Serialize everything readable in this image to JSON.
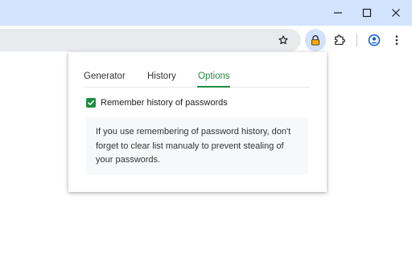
{
  "window_controls": {
    "minimize_icon": "minimize-icon",
    "maximize_icon": "maximize-icon",
    "close_icon": "close-icon"
  },
  "toolbar": {
    "icons": [
      "star-icon",
      "lock-icon",
      "puzzle-icon",
      "profile-icon",
      "more-vert-icon"
    ]
  },
  "popup": {
    "tabs": [
      {
        "label": "Generator",
        "active": false
      },
      {
        "label": "History",
        "active": false
      },
      {
        "label": "Options",
        "active": true
      }
    ],
    "options": {
      "remember_history": {
        "label": "Remember history of passwords",
        "checked": true
      }
    },
    "note": "If you use remembering of password history, don't forget to clear list manualy to prevent stealing of your passwords."
  },
  "colors": {
    "titlebar": "#d3e3fd",
    "accent": "#1e8e3e",
    "omnibox": "#e8eaed",
    "note_bg": "#f7f8fa"
  }
}
